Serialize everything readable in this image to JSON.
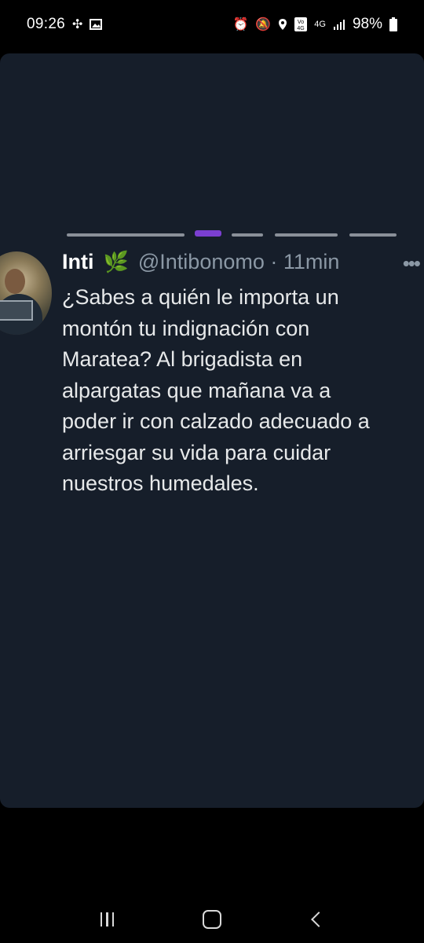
{
  "status_bar": {
    "time": "09:26",
    "battery": "98%",
    "network": "4G",
    "left_icons": [
      "pinwheel-icon",
      "image-icon"
    ],
    "right_icons": [
      "alarm-icon",
      "mute-icon",
      "location-icon",
      "volte-icon",
      "network-4g-icon",
      "signal-icon",
      "battery-icon"
    ]
  },
  "tweet": {
    "display_name": "Inti",
    "emoji": "🌿",
    "handle_line": "@Intibonomo · 11min",
    "text_lines": [
      "¿Sabes a quién le importa un",
      "montón tu indignación con",
      "Maratea? Al brigadista en",
      "alpargatas que mañana va a",
      "poder ir con calzado adecuado a",
      "arriesgar su vida para cuidar",
      "nuestros humedales."
    ]
  },
  "colors": {
    "card_background": "#161e2a",
    "handle": "#8b98a5",
    "text": "#e7e9ea"
  },
  "nav_bar": {
    "buttons": [
      "recents-icon",
      "home-icon",
      "back-icon"
    ]
  }
}
